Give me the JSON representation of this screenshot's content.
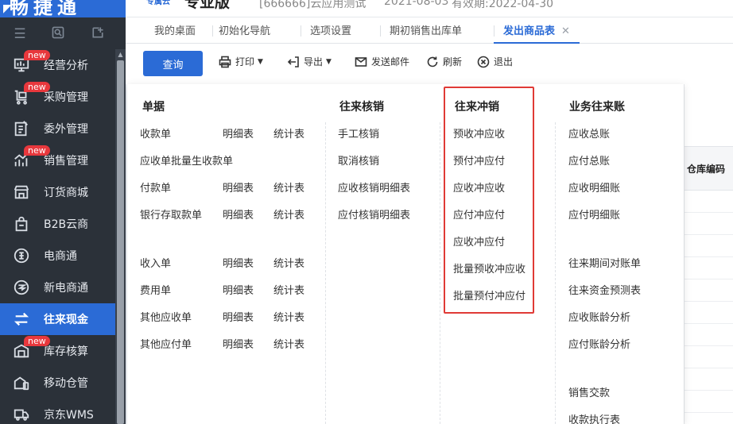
{
  "brand": {
    "name": "畅捷通"
  },
  "topbar": {
    "logo": "专属云",
    "edition": "专业版",
    "account": "[666666]云应用测试",
    "date": "2021-08-03",
    "valid": "有效期:2022-04-30"
  },
  "sidebar": {
    "new_label": "new",
    "items": [
      {
        "label": "经营分析",
        "icon": "chart-bar-icon",
        "new": true
      },
      {
        "label": "采购管理",
        "icon": "cart-icon",
        "new": true
      },
      {
        "label": "委外管理",
        "icon": "clipboard-icon",
        "new": false
      },
      {
        "label": "销售管理",
        "icon": "sales-chart-icon",
        "new": true
      },
      {
        "label": "订货商城",
        "icon": "store-icon",
        "new": false
      },
      {
        "label": "B2B云商",
        "icon": "shopping-bag-icon",
        "new": false
      },
      {
        "label": "电商通",
        "icon": "ecommerce-circle-icon",
        "new": false
      },
      {
        "label": "新电商通",
        "icon": "new-ecommerce-icon",
        "new": false
      },
      {
        "label": "往来现金",
        "icon": "transfer-arrows-icon",
        "new": false,
        "active": true
      },
      {
        "label": "库存核算",
        "icon": "inventory-icon",
        "new": true
      },
      {
        "label": "移动仓管",
        "icon": "mobile-warehouse-icon",
        "new": false
      },
      {
        "label": "京东WMS",
        "icon": "truck-icon",
        "new": false
      }
    ]
  },
  "tabs": [
    {
      "label": "我的桌面"
    },
    {
      "label": "初始化导航"
    },
    {
      "label": "选项设置"
    },
    {
      "label": "期初销售出库单"
    },
    {
      "label": "发出商品表",
      "active": true
    }
  ],
  "toolbar": {
    "query": "查询",
    "print": "打印",
    "export": "导出",
    "email": "发送邮件",
    "refresh": "刷新",
    "exit": "退出"
  },
  "table": {
    "header": "仓库编码"
  },
  "panel": {
    "documents": {
      "title": "单据",
      "rows": [
        {
          "name": "收款单",
          "detail": "明细表",
          "stats": "统计表"
        },
        {
          "name": "应收单批量生收款单"
        },
        {
          "name": "付款单",
          "detail": "明细表",
          "stats": "统计表"
        },
        {
          "name": "银行存取款单",
          "detail": "明细表",
          "stats": "统计表"
        },
        {
          "name": "收入单",
          "detail": "明细表",
          "stats": "统计表"
        },
        {
          "name": "费用单",
          "detail": "明细表",
          "stats": "统计表"
        },
        {
          "name": "其他应收单",
          "detail": "明细表",
          "stats": "统计表"
        },
        {
          "name": "其他应付单",
          "detail": "明细表",
          "stats": "统计表"
        }
      ]
    },
    "verification": {
      "title": "往来核销",
      "items": [
        "手工核销",
        "取消核销",
        "应收核销明细表",
        "应付核销明细表"
      ]
    },
    "offset": {
      "title": "往来冲销",
      "items": [
        "预收冲应收",
        "预付冲应付",
        "应收冲应收",
        "应付冲应付",
        "应收冲应付",
        "批量预收冲应收",
        "批量预付冲应付"
      ]
    },
    "ledger": {
      "title": "业务往来账",
      "items": [
        "应收总账",
        "应付总账",
        "应收明细账",
        "应付明细账",
        "往来期间对账单",
        "往来资金预测表",
        "应收账龄分析",
        "应付账龄分析",
        "销售交款",
        "收款执行表"
      ]
    }
  }
}
